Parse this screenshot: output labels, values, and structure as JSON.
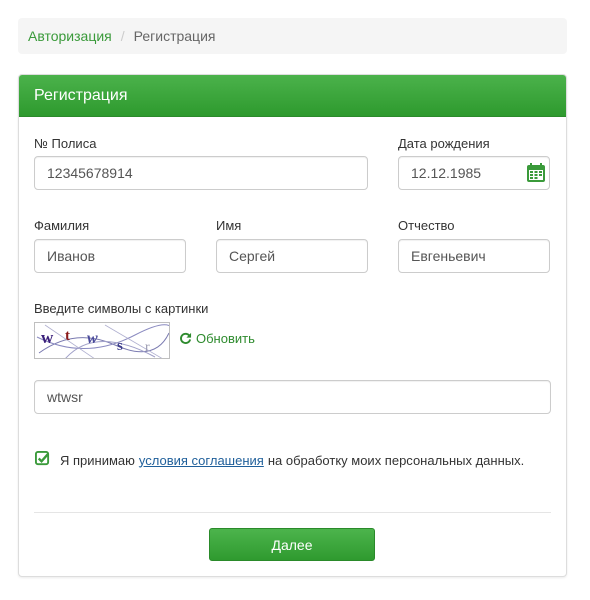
{
  "breadcrumb": {
    "items": [
      {
        "label": "Авторизация",
        "active": false
      },
      {
        "label": "Регистрация",
        "active": true
      }
    ],
    "separator": "/"
  },
  "panel": {
    "title": "Регистрация"
  },
  "form": {
    "policy": {
      "label": "№ Полиса",
      "value": "12345678914"
    },
    "birthdate": {
      "label": "Дата рождения",
      "value": "12.12.1985"
    },
    "lastname": {
      "label": "Фамилия",
      "value": "Иванов"
    },
    "firstname": {
      "label": "Имя",
      "value": "Сергей"
    },
    "patronymic": {
      "label": "Отчество",
      "value": "Евгеньевич"
    },
    "captcha": {
      "label": "Введите символы с картинки",
      "refresh_label": "Обновить",
      "value": "wtwsr"
    },
    "agreement": {
      "checked": true,
      "text_before": "Я принимаю",
      "link_text": "условия соглашения",
      "text_after": "на обработку моих персональных данных."
    },
    "submit_label": "Далее"
  },
  "colors": {
    "accent": "#3a9a3a",
    "header_gradient_top": "#4bb24b",
    "header_gradient_bottom": "#2e9a2e",
    "link": "#1f5f9a"
  },
  "icons": {
    "calendar": "calendar-icon",
    "refresh": "refresh-icon",
    "checkbox": "checkbox-checked-icon"
  }
}
